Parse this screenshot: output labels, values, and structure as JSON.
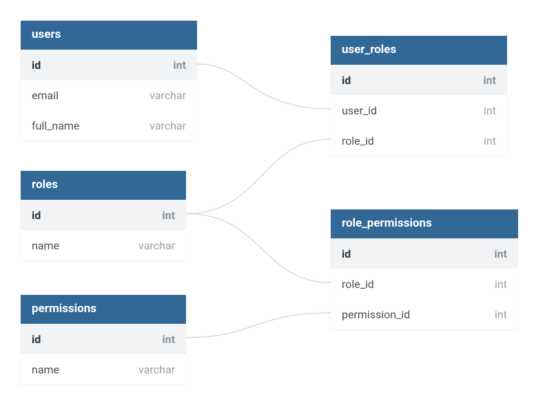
{
  "colors": {
    "header_bg": "#316896",
    "pk_bg": "#f2f3f4",
    "connector": "#d7dbdf"
  },
  "tables": {
    "users": {
      "title": "users",
      "columns": [
        {
          "name": "id",
          "type": "int",
          "pk": true
        },
        {
          "name": "email",
          "type": "varchar",
          "pk": false
        },
        {
          "name": "full_name",
          "type": "varchar",
          "pk": false
        }
      ]
    },
    "roles": {
      "title": "roles",
      "columns": [
        {
          "name": "id",
          "type": "int",
          "pk": true
        },
        {
          "name": "name",
          "type": "varchar",
          "pk": false
        }
      ]
    },
    "permissions": {
      "title": "permissions",
      "columns": [
        {
          "name": "id",
          "type": "int",
          "pk": true
        },
        {
          "name": "name",
          "type": "varchar",
          "pk": false
        }
      ]
    },
    "user_roles": {
      "title": "user_roles",
      "columns": [
        {
          "name": "id",
          "type": "int",
          "pk": true
        },
        {
          "name": "user_id",
          "type": "int",
          "pk": false
        },
        {
          "name": "role_id",
          "type": "int",
          "pk": false
        }
      ]
    },
    "role_permissions": {
      "title": "role_permissions",
      "columns": [
        {
          "name": "id",
          "type": "int",
          "pk": true
        },
        {
          "name": "role_id",
          "type": "int",
          "pk": false
        },
        {
          "name": "permission_id",
          "type": "int",
          "pk": false
        }
      ]
    }
  },
  "relationships": [
    {
      "from": "users.id",
      "to": "user_roles.user_id"
    },
    {
      "from": "roles.id",
      "to": "user_roles.role_id"
    },
    {
      "from": "roles.id",
      "to": "role_permissions.role_id"
    },
    {
      "from": "permissions.id",
      "to": "role_permissions.permission_id"
    }
  ]
}
